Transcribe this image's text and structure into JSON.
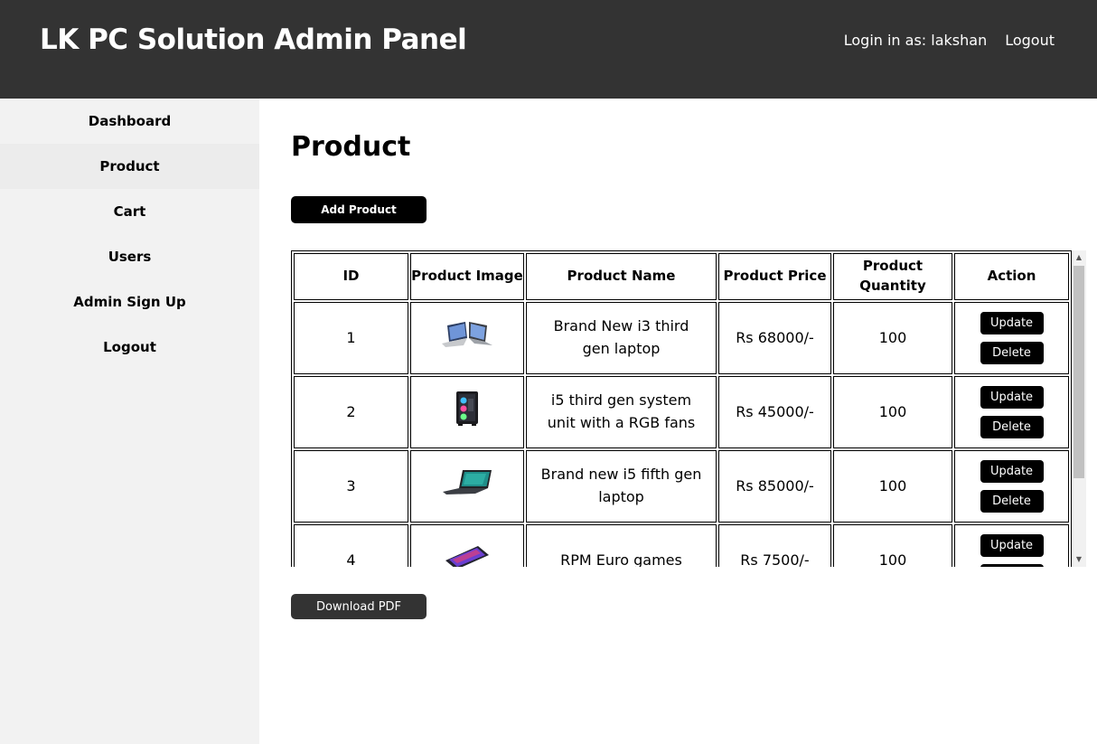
{
  "header": {
    "title": "LK PC Solution Admin Panel",
    "login_text": "Login in as: lakshan",
    "logout_label": "Logout"
  },
  "sidebar": {
    "items": [
      {
        "label": "Dashboard"
      },
      {
        "label": "Product"
      },
      {
        "label": "Cart"
      },
      {
        "label": "Users"
      },
      {
        "label": "Admin Sign Up"
      },
      {
        "label": "Logout"
      }
    ]
  },
  "main": {
    "title": "Product",
    "add_button": "Add Product",
    "download_button": "Download PDF"
  },
  "table": {
    "headers": [
      "ID",
      "Product Image",
      "Product Name",
      "Product Price",
      "Product Quantity",
      "Action"
    ],
    "rows": [
      {
        "id": "1",
        "image": "laptop-image",
        "name": "Brand New i3 third gen laptop",
        "price": "Rs 68000/-",
        "quantity": "100"
      },
      {
        "id": "2",
        "image": "pc-tower-image",
        "name": "i5 third gen system unit with a RGB fans",
        "price": "Rs 45000/-",
        "quantity": "100"
      },
      {
        "id": "3",
        "image": "laptop-image",
        "name": "Brand new i5 fifth gen laptop",
        "price": "Rs 85000/-",
        "quantity": "100"
      },
      {
        "id": "4",
        "image": "keyboard-image",
        "name": "RPM Euro games",
        "price": "Rs 7500/-",
        "quantity": "100"
      }
    ],
    "update_label": "Update",
    "delete_label": "Delete"
  }
}
